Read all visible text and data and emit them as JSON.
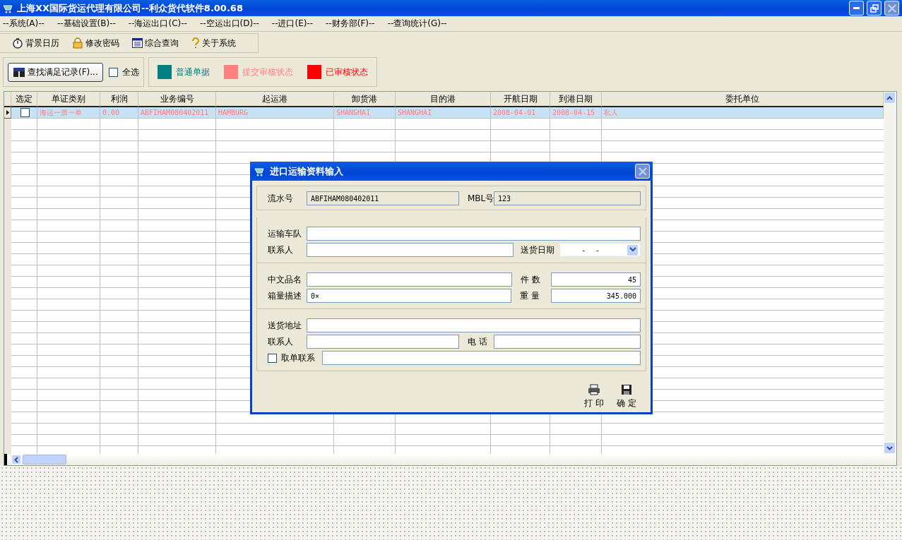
{
  "window": {
    "title": "上海XX国际货运代理有限公司--利众货代软件8.00.68"
  },
  "menu": [
    "--系统(A)--",
    "--基础设置(B)--",
    "--海运出口(C)--",
    "--空运出口(D)--",
    "--进口(E)--",
    "--财务部(F)--",
    "--查询统计(G)--"
  ],
  "toolbar": [
    {
      "label": "背景日历",
      "kind": "clock"
    },
    {
      "label": "修改密码",
      "kind": "lock"
    },
    {
      "label": "综合查询",
      "kind": "calendar"
    },
    {
      "label": "关于系统",
      "kind": "help"
    }
  ],
  "filter": {
    "find_button": "查找满足记录(F)...",
    "select_all": {
      "label": "全选",
      "checked": false
    },
    "legend": [
      {
        "label": "普通单据",
        "color": "#008080"
      },
      {
        "label": "提交审核状态",
        "color": "#ff8080"
      },
      {
        "label": "已审核状态",
        "color": "#ff0000"
      }
    ]
  },
  "table": {
    "columns": [
      "选定",
      "单证类别",
      "利润",
      "业务编号",
      "起运港",
      "卸货港",
      "目的港",
      "开航日期",
      "到港日期",
      "委托单位"
    ],
    "rows": [
      {
        "selected": true,
        "checked": false,
        "kind": "submitted",
        "cells": [
          "",
          "海运一票一单",
          "0.00",
          "ABFIHAM080402011",
          "HAMBURG",
          "SHANGHAI",
          "SHANGHAI",
          "2008-04-01",
          "2008-04-15",
          "私人"
        ]
      }
    ]
  },
  "dialog": {
    "title": "进口运输资料输入",
    "sections": [
      [
        [
          {
            "label": "流水号",
            "value": "ABFIHAM080402011",
            "kind": "readonly"
          },
          {
            "label": "MBL号",
            "value": "123",
            "kind": "readonly"
          }
        ]
      ],
      [
        [
          {
            "label": "运输车队",
            "kind": "text"
          }
        ],
        [
          {
            "label": "联系人",
            "kind": "text"
          },
          {
            "label": "送货日期",
            "value": "-  -",
            "kind": "date"
          }
        ]
      ],
      [
        [
          {
            "label": "中文品名",
            "kind": "text"
          },
          {
            "label": "件 数",
            "value": "45",
            "kind": "number"
          }
        ],
        [
          {
            "label": "箱量描述",
            "value": "0×",
            "kind": "text"
          },
          {
            "label": "重 量",
            "value": "345.000",
            "kind": "number"
          }
        ]
      ],
      [
        [
          {
            "label": "送货地址",
            "kind": "text"
          }
        ],
        [
          {
            "label": "联系人",
            "kind": "text"
          },
          {
            "label": "电 话",
            "kind": "text"
          }
        ],
        [
          {
            "label": "取单联系",
            "kind": "checkbox",
            "checked": false
          }
        ]
      ]
    ],
    "buttons": [
      {
        "label": "打 印",
        "kind": "print"
      },
      {
        "label": "确 定",
        "kind": "save"
      }
    ]
  }
}
